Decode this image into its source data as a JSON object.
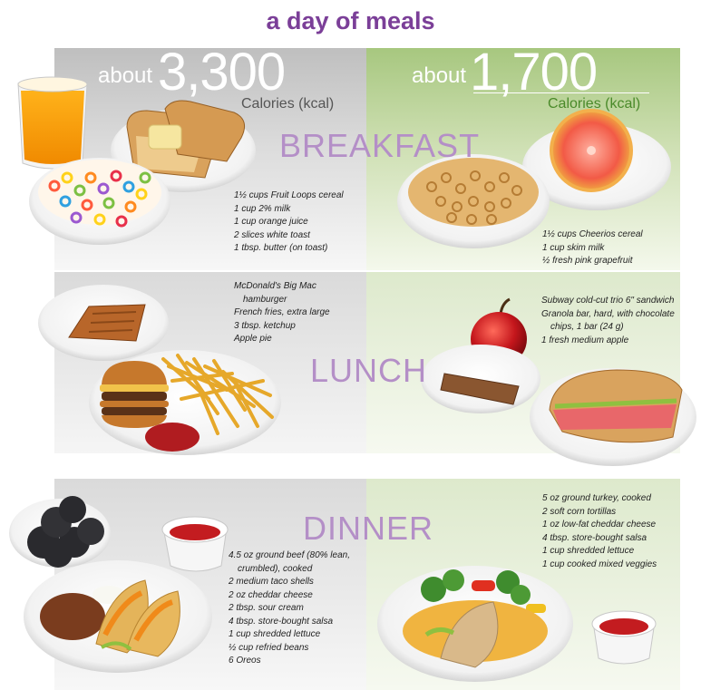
{
  "title": "a day of meals",
  "left": {
    "about": "about",
    "calories": "3,300",
    "unit": "Calories (kcal)"
  },
  "right": {
    "about": "about",
    "calories": "1,700",
    "unit": "Calories (kcal)"
  },
  "meals": {
    "breakfast": "BREAKFAST",
    "lunch": "LUNCH",
    "dinner": "DINNER"
  },
  "breakfast_high": [
    "1½ cups Fruit Loops cereal",
    "1 cup 2% milk",
    "1 cup orange juice",
    "2 slices white toast",
    "1 tbsp. butter (on toast)"
  ],
  "breakfast_low": [
    "1½ cups Cheerios cereal",
    "1 cup skim milk",
    "½ fresh pink grapefruit"
  ],
  "lunch_high": [
    "McDonald's Big Mac",
    "hamburger",
    "French fries, extra large",
    "3 tbsp. ketchup",
    "Apple pie"
  ],
  "lunch_low": [
    "Subway cold-cut trio 6\" sandwich",
    "Granola bar, hard, with chocolate",
    "chips, 1 bar (24 g)",
    "1 fresh medium apple"
  ],
  "dinner_high": [
    "4.5 oz ground beef (80% lean,",
    "crumbled), cooked",
    "2 medium taco shells",
    "2 oz cheddar cheese",
    "2 tbsp. sour cream",
    "4 tbsp. store-bought salsa",
    "1 cup shredded lettuce",
    "½ cup refried beans",
    "6 Oreos"
  ],
  "dinner_low": [
    "5 oz ground turkey, cooked",
    "2 soft corn tortillas",
    "1 oz low-fat cheddar cheese",
    "4 tbsp. store-bought salsa",
    "1 cup shredded lettuce",
    "1 cup cooked mixed veggies"
  ],
  "colors": {
    "title": "#7b3f98",
    "meal_label": "#b48fc7",
    "unit_left": "#555555",
    "unit_right": "#4a8a2a",
    "high_panel": "#c4c4c4",
    "low_panel": "#a9c883"
  }
}
